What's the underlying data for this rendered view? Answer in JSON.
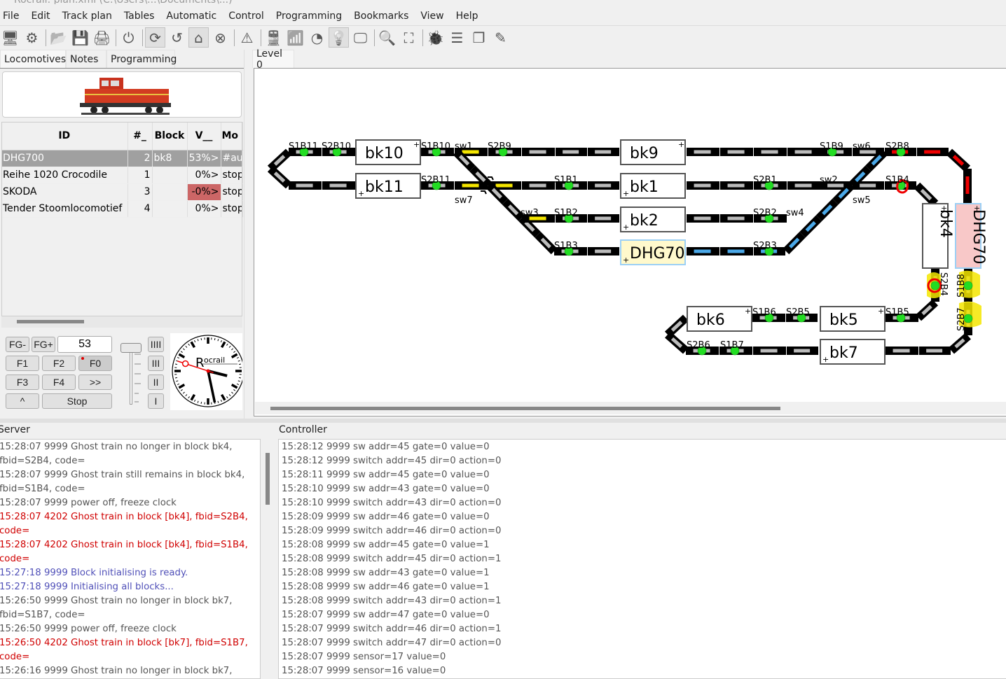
{
  "window": {
    "title": "Rocrail: plan.xml (C:\\Users\\...\\Documents\\...)"
  },
  "menu": [
    "File",
    "Edit",
    "Track plan",
    "Tables",
    "Automatic",
    "Control",
    "Programming",
    "Bookmarks",
    "View",
    "Help"
  ],
  "toolbar": [
    {
      "name": "rocrail-server-icon",
      "glyph": "🖥"
    },
    {
      "name": "settings-icon",
      "glyph": "⚙"
    },
    {
      "sep": true
    },
    {
      "name": "open-folder-icon",
      "glyph": "📂"
    },
    {
      "name": "save-icon",
      "glyph": "💾"
    },
    {
      "name": "print-icon",
      "glyph": "🖨"
    },
    {
      "sep": true
    },
    {
      "name": "power-icon",
      "glyph": "⏻"
    },
    {
      "sep": true
    },
    {
      "name": "auto-mode-icon",
      "glyph": "⟳",
      "active": true
    },
    {
      "name": "reset-icon",
      "glyph": "↺"
    },
    {
      "name": "home-icon",
      "glyph": "⌂",
      "active": true
    },
    {
      "name": "cancel-icon",
      "glyph": "⊗"
    },
    {
      "sep": true
    },
    {
      "name": "emergency-warning-icon",
      "glyph": "⚠"
    },
    {
      "sep": true
    },
    {
      "name": "train-icon",
      "glyph": "🚆"
    },
    {
      "name": "wifi-icon",
      "glyph": "📶"
    },
    {
      "name": "speedometer-icon",
      "glyph": "◔"
    },
    {
      "name": "lightbulb-icon",
      "glyph": "💡",
      "active": true
    },
    {
      "name": "monitor-icon",
      "glyph": "🖵"
    },
    {
      "sep": true
    },
    {
      "name": "search-icon",
      "glyph": "🔍"
    },
    {
      "name": "fullscreen-icon",
      "glyph": "⛶"
    },
    {
      "sep": true
    },
    {
      "name": "bug-icon",
      "glyph": "🐞"
    },
    {
      "name": "list-icon",
      "glyph": "☰"
    },
    {
      "name": "copy-pages-icon",
      "glyph": "❐"
    },
    {
      "name": "edit-notes-icon",
      "glyph": "✎"
    }
  ],
  "left_tabs": [
    "Locomotives",
    "Notes",
    "Programming"
  ],
  "loco_table": {
    "headers": [
      "ID",
      "#_",
      "Block",
      "V__",
      "Mo"
    ],
    "rows": [
      {
        "id": "DHG700",
        "num": "2",
        "block": "bk8",
        "v": "53%>",
        "mode": "#aut",
        "selected": true
      },
      {
        "id": "Reihe 1020 Crocodile",
        "num": "1",
        "block": "",
        "v": "0%>",
        "mode": "stop"
      },
      {
        "id": "SKODA",
        "num": "3",
        "block": "",
        "v": "-0%>",
        "mode": "stop",
        "highlight": true
      },
      {
        "id": "Tender Stoomlocomotief",
        "num": "4",
        "block": "",
        "v": "0%>",
        "mode": "stop"
      }
    ]
  },
  "throttle": {
    "fg_minus": "FG-",
    "fg_plus": "FG+",
    "speed": "53",
    "f1": "F1",
    "f2": "F2",
    "f0": "F0",
    "f3": "F3",
    "f4": "F4",
    "more": ">>",
    "dir": "^",
    "stop": "Stop",
    "steps": [
      "IIII",
      "III",
      "II",
      "I"
    ],
    "speed_slider_fraction": 0.0
  },
  "clock": {
    "brand": "Rocrail",
    "hour": 15,
    "minute": 28,
    "second": 48
  },
  "plan_tabs": [
    "Level 0"
  ],
  "plan": {
    "blocks": {
      "bk10": "bk10",
      "bk11": "bk11",
      "bk9": "bk9",
      "bk1": "bk1",
      "bk2": "bk2",
      "bk3": "DHG70",
      "bk4": "bk4",
      "bk8": "DHG70",
      "bk6": "bk6",
      "bk5": "bk5",
      "bk7": "bk7"
    },
    "sensors": [
      "S1B11",
      "S2B10",
      "S1B10",
      "S2B11",
      "S2B9",
      "S1B1",
      "S2B1",
      "S1B2",
      "S2B2",
      "S1B3",
      "S2B3",
      "S1B9",
      "S2B8",
      "S1B4",
      "S2B4",
      "S1B8",
      "S2B7",
      "S1B6",
      "S2B5",
      "S1B5",
      "S2B6",
      "S1B7"
    ],
    "switches": [
      "sw1",
      "sw7",
      "sw3",
      "sw6",
      "sw2",
      "sw5",
      "sw4"
    ]
  },
  "server_log": {
    "label": "Server",
    "lines": [
      {
        "text": "15:28:07 9999 Ghost train no longer in block bk4,",
        "c": "gray"
      },
      {
        "text": "fbid=S2B4, code=",
        "c": "gray"
      },
      {
        "text": "15:28:07 9999 Ghost train still remains in block bk4,",
        "c": "gray"
      },
      {
        "text": "fbid=S1B4, code=",
        "c": "gray"
      },
      {
        "text": "15:28:07 9999 power off, freeze clock",
        "c": "gray"
      },
      {
        "text": "15:28:07 4202 Ghost train in block [bk4], fbid=S2B4,",
        "c": "red"
      },
      {
        "text": "code=",
        "c": "red"
      },
      {
        "text": "15:28:07 4202 Ghost train in block [bk4], fbid=S1B4,",
        "c": "red"
      },
      {
        "text": "code=",
        "c": "red"
      },
      {
        "text": "15:27:18 9999 Block initialising is ready.",
        "c": "blue"
      },
      {
        "text": "15:27:18 9999 Initialising all blocks...",
        "c": "blue"
      },
      {
        "text": "15:26:50 9999 Ghost train no longer in block bk7,",
        "c": "gray"
      },
      {
        "text": "fbid=S1B7, code=",
        "c": "gray"
      },
      {
        "text": "15:26:50 9999 power off, freeze clock",
        "c": "gray"
      },
      {
        "text": "15:26:50 4202 Ghost train in block [bk7], fbid=S1B7,",
        "c": "red"
      },
      {
        "text": "code=",
        "c": "red"
      },
      {
        "text": "15:26:16 9999 Ghost train no longer in block bk7,",
        "c": "gray"
      }
    ]
  },
  "controller_log": {
    "label": "Controller",
    "lines": [
      "15:28:12 9999 sw addr=45 gate=0 value=0",
      "15:28:12 9999 switch addr=45 dir=0 action=0",
      "15:28:11 9999 sw addr=45 gate=0 value=0",
      "15:28:10 9999 sw addr=43 gate=0 value=0",
      "15:28:10 9999 switch addr=43 dir=0 action=0",
      "15:28:09 9999 sw addr=46 gate=0 value=0",
      "15:28:09 9999 switch addr=46 dir=0 action=0",
      "15:28:08 9999 sw addr=45 gate=0 value=1",
      "15:28:08 9999 switch addr=45 dir=0 action=1",
      "15:28:08 9999 sw addr=43 gate=0 value=1",
      "15:28:08 9999 sw addr=46 gate=0 value=1",
      "15:28:08 9999 switch addr=43 dir=0 action=1",
      "15:28:07 9999 sw addr=47 gate=0 value=0",
      "15:28:07 9999 switch addr=46 dir=0 action=1",
      "15:28:07 9999 switch addr=47 dir=0 action=0",
      "15:28:07 9999 sensor=17 value=0",
      "15:28:07 9999 sensor=16 value=0"
    ]
  }
}
